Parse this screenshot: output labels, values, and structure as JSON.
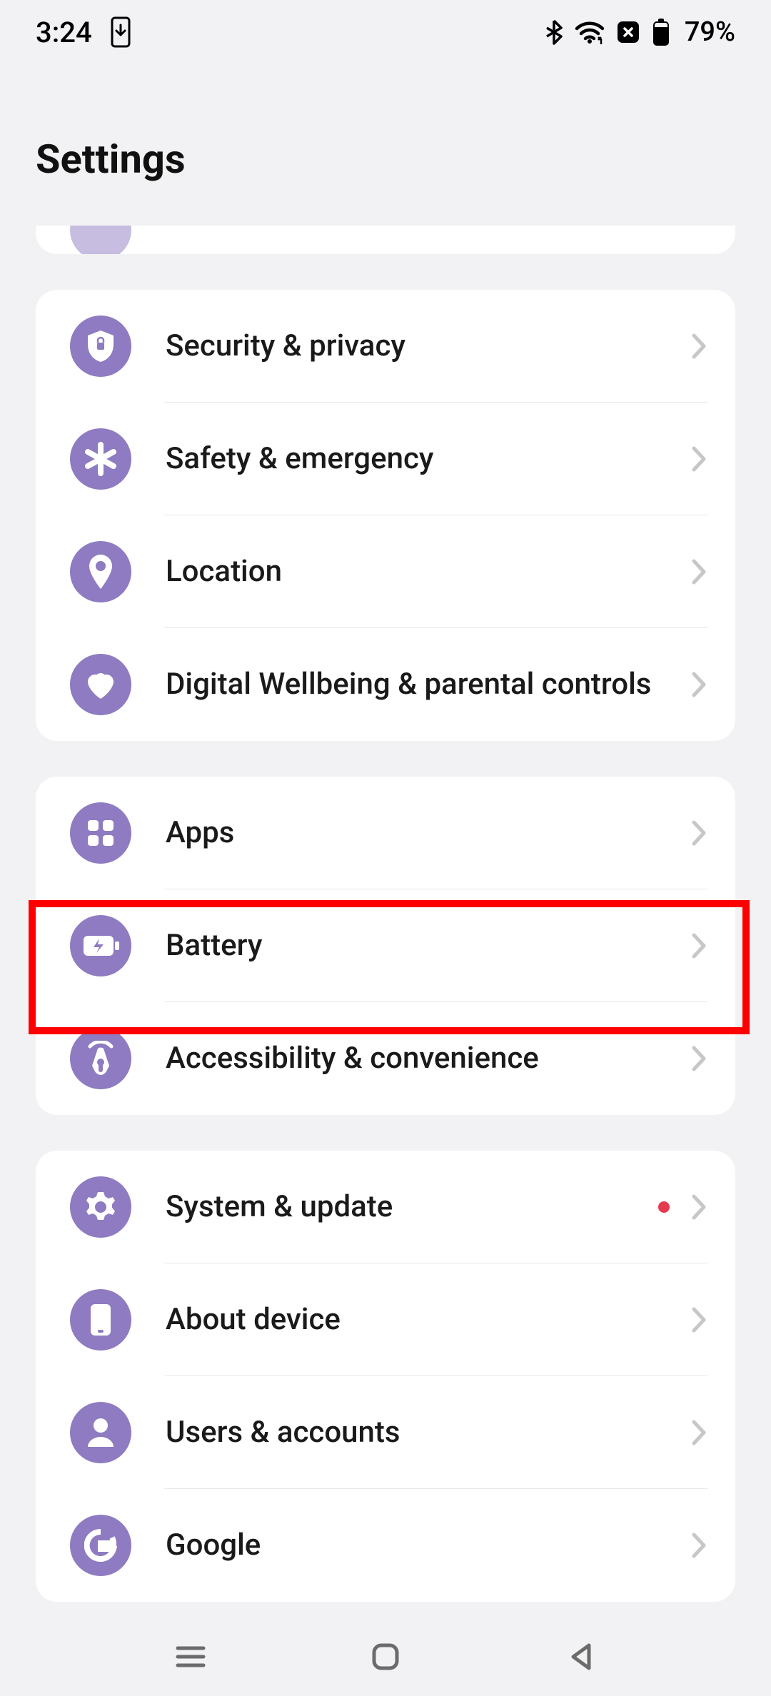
{
  "status": {
    "time": "3:24",
    "battery_text": "79%"
  },
  "header": {
    "title": "Settings"
  },
  "groups": [
    {
      "rows": [
        {
          "icon": "shield",
          "label": "Security & privacy",
          "name": "security-privacy",
          "divider": true
        },
        {
          "icon": "asterisk",
          "label": "Safety & emergency",
          "name": "safety-emergency",
          "divider": true
        },
        {
          "icon": "location",
          "label": "Location",
          "name": "location",
          "divider": true
        },
        {
          "icon": "heart",
          "label": "Digital Wellbeing & parental controls",
          "name": "digital-wellbeing",
          "divider": false
        }
      ]
    },
    {
      "rows": [
        {
          "icon": "apps",
          "label": "Apps",
          "name": "apps",
          "divider": true
        },
        {
          "icon": "battery",
          "label": "Battery",
          "name": "battery",
          "divider": true
        },
        {
          "icon": "accessibility",
          "label": "Accessibility & convenience",
          "name": "accessibility",
          "divider": false
        }
      ]
    },
    {
      "rows": [
        {
          "icon": "gear",
          "label": "System & update",
          "name": "system-update",
          "divider": true,
          "dot": true
        },
        {
          "icon": "phone",
          "label": "About device",
          "name": "about-device",
          "divider": true
        },
        {
          "icon": "person",
          "label": "Users & accounts",
          "name": "users-accounts",
          "divider": true
        },
        {
          "icon": "google",
          "label": "Google",
          "name": "google",
          "divider": false
        }
      ]
    }
  ]
}
